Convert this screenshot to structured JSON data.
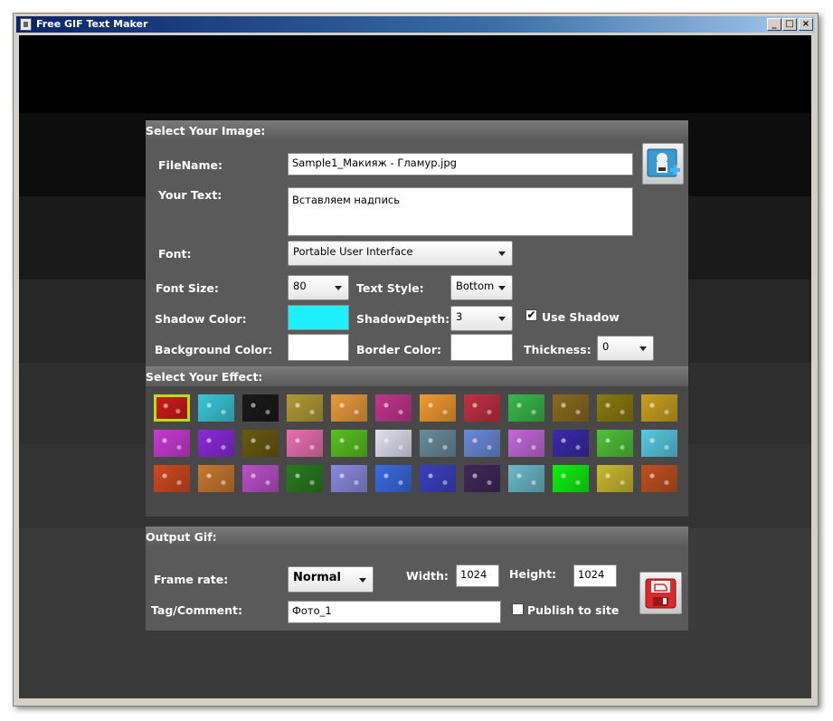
{
  "window": {
    "title": "Free GIF Text Maker",
    "min_label": "_",
    "max_label": "□",
    "close_label": "×"
  },
  "image_section": {
    "header": "Select Your Image:",
    "filename_label": "FileName:",
    "filename_value": "Sample1_Макияж - Гламур.jpg",
    "text_label": "Your Text:",
    "text_value": "Вставляем надпись",
    "font_label": "Font:",
    "font_value": "Portable User Interface",
    "fontsize_label": "Font Size:",
    "fontsize_value": "80",
    "textstyle_label": "Text Style:",
    "textstyle_value": "Bottom",
    "shadowcolor_label": "Shadow Color:",
    "shadowcolor_value": "#1ff0ff",
    "shadowdepth_label": "ShadowDepth:",
    "shadowdepth_value": "3",
    "useshadow_label": "Use Shadow",
    "useshadow_checked": "✔",
    "bgcolor_label": "Background Color:",
    "bgcolor_value": "#ffffff",
    "bordercolor_label": "Border Color:",
    "bordercolor_value": "#ffffff",
    "thickness_label": "Thickness:",
    "thickness_value": "0"
  },
  "effect_section": {
    "header": "Select Your Effect:",
    "effects": [
      "#cc1b1b",
      "#39c7d6",
      "#1a1a1a",
      "#b09a35",
      "#e89a3c",
      "#c0368c",
      "#f09a30",
      "#c03040",
      "#38b84a",
      "#8a6a20",
      "#8a7a10",
      "#c8a020",
      "#c83ad0",
      "#8a2ad8",
      "#6a5a10",
      "#e870b0",
      "#58c020",
      "#e0e0f0",
      "#6a8a9a",
      "#6a8ad8",
      "#c068d8",
      "#3a2aa8",
      "#50c038",
      "#58c8e0",
      "#d04a20",
      "#c87830",
      "#b850c8",
      "#2a7a20",
      "#8a8ae0",
      "#3a6ae0",
      "#3a40c0",
      "#40285a",
      "#6ab8c8",
      "#10f010",
      "#c8b830",
      "#c05020"
    ]
  },
  "output_section": {
    "header": "Output Gif:",
    "framerate_label": "Frame rate:",
    "framerate_value": "Normal",
    "width_label": "Width:",
    "width_value": "1024",
    "height_label": "Height:",
    "height_value": "1024",
    "tag_label": "Tag/Comment:",
    "tag_value": "Фото_1",
    "publish_label": "Publish to site"
  },
  "icons": {
    "add_image": "add-image-icon",
    "save": "save-disk-icon"
  }
}
